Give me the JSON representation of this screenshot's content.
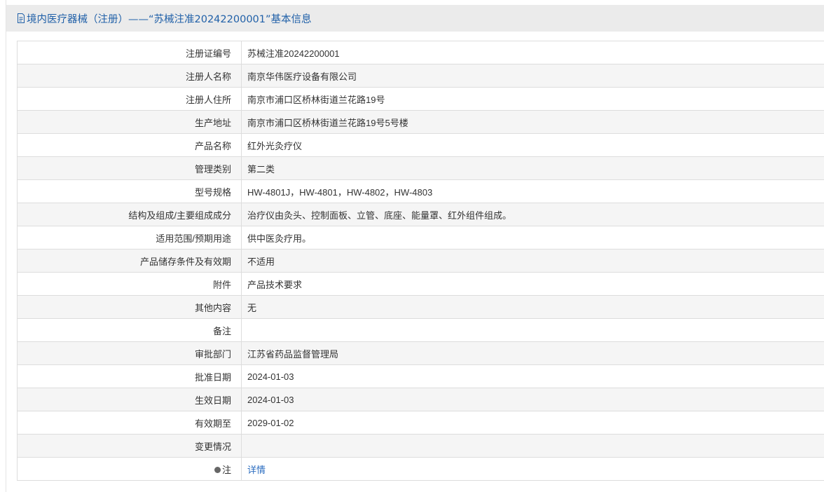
{
  "header": {
    "title": "境内医疗器械（注册）——“苏械注准20242200001”基本信息",
    "icon": "document-icon"
  },
  "rows": [
    {
      "label": "注册证编号",
      "value": "苏械注准20242200001"
    },
    {
      "label": "注册人名称",
      "value": "南京华伟医疗设备有限公司"
    },
    {
      "label": "注册人住所",
      "value": "南京市浦口区桥林街道兰花路19号"
    },
    {
      "label": "生产地址",
      "value": "南京市浦口区桥林街道兰花路19号5号楼"
    },
    {
      "label": "产品名称",
      "value": "红外光灸疗仪"
    },
    {
      "label": "管理类别",
      "value": "第二类"
    },
    {
      "label": "型号规格",
      "value": "HW-4801J，HW-4801，HW-4802，HW-4803"
    },
    {
      "label": "结构及组成/主要组成成分",
      "value": "治疗仪由灸头、控制面板、立管、底座、能量罩、红外组件组成。"
    },
    {
      "label": "适用范围/预期用途",
      "value": "供中医灸疗用。"
    },
    {
      "label": "产品储存条件及有效期",
      "value": "不适用"
    },
    {
      "label": "附件",
      "value": "产品技术要求"
    },
    {
      "label": "其他内容",
      "value": "无"
    },
    {
      "label": "备注",
      "value": ""
    },
    {
      "label": "审批部门",
      "value": "江苏省药品监督管理局"
    },
    {
      "label": "批准日期",
      "value": "2024-01-03"
    },
    {
      "label": "生效日期",
      "value": "2024-01-03"
    },
    {
      "label": "有效期至",
      "value": "2029-01-02"
    },
    {
      "label": "变更情况",
      "value": ""
    }
  ],
  "note_row": {
    "label": "注",
    "link": "详情"
  }
}
